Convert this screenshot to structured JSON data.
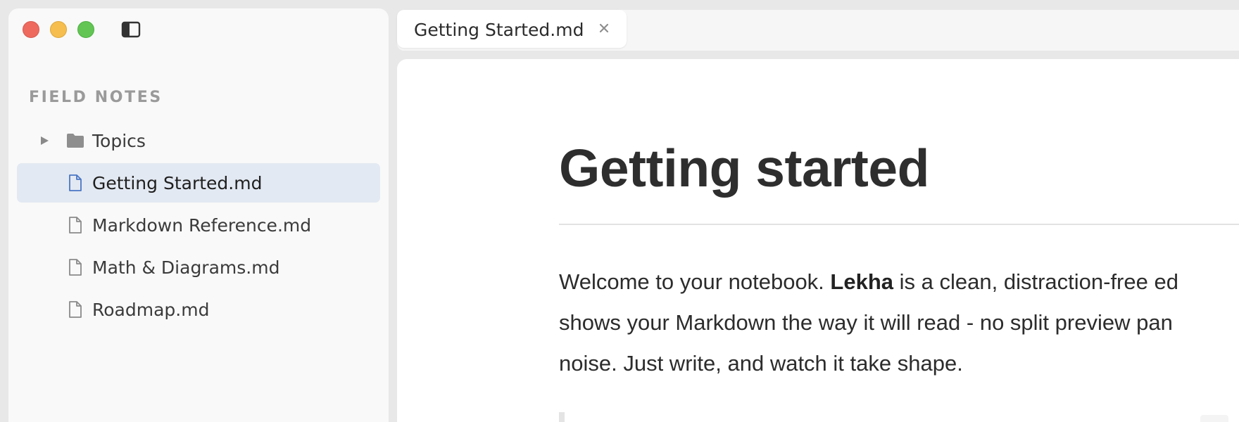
{
  "sidebar": {
    "section_title": "FIELD NOTES",
    "items": [
      {
        "label": "Topics",
        "type": "folder",
        "expanded": false
      },
      {
        "label": "Getting Started.md",
        "type": "file",
        "active": true
      },
      {
        "label": "Markdown Reference.md",
        "type": "file"
      },
      {
        "label": "Math & Diagrams.md",
        "type": "file"
      },
      {
        "label": "Roadmap.md",
        "type": "file"
      }
    ]
  },
  "tabs": [
    {
      "label": "Getting Started.md",
      "active": true
    }
  ],
  "document": {
    "title": "Getting started",
    "paragraph": {
      "line1_prefix": "Welcome to your notebook. ",
      "line1_bold": "Lekha",
      "line1_suffix": " is a clean, distraction-free ed",
      "line2": "shows your Markdown the way it will read - no split preview pan",
      "line3": "noise. Just write, and watch it take shape."
    }
  },
  "colors": {
    "traffic_close": "#ee6a5f",
    "traffic_minimize": "#f5be4f",
    "traffic_maximize": "#62c554",
    "active_item_bg": "#e3e9f2",
    "active_file_icon": "#4a76c4",
    "file_icon": "#8a8a8a"
  },
  "icons": {
    "sidebar_toggle": "sidebar-toggle-icon",
    "folder": "folder-icon",
    "file": "file-icon",
    "chevron": "chevron-right-icon",
    "close": "close-icon"
  }
}
